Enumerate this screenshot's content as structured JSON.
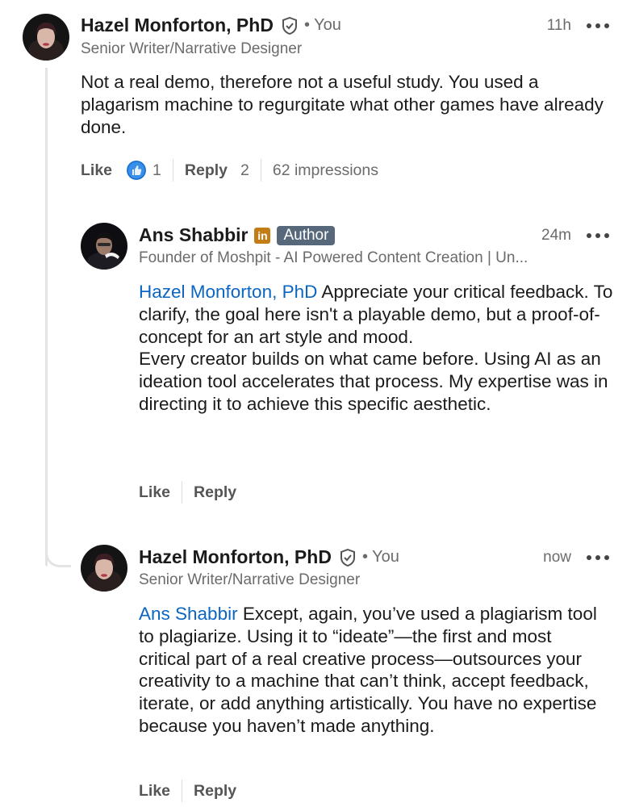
{
  "comments": [
    {
      "name": "Hazel Monforton, PhD",
      "you_label": "• You",
      "subtitle": "Senior Writer/Narrative Designer",
      "time": "11h",
      "body": "Not a real demo, therefore not a useful study. You used a plagarism machine to regurgitate what other games have already done.",
      "like_label": "Like",
      "like_count": "1",
      "reply_label": "Reply",
      "reply_count": "2",
      "impressions": "62 impressions"
    },
    {
      "name": "Ans Shabbir",
      "linkedin_badge": "in",
      "author_badge": "Author",
      "subtitle": "Founder of Moshpit - AI Powered Content Creation | Un...",
      "time": "24m",
      "mention": "Hazel Monforton, PhD",
      "body_p1": " Appreciate your critical feedback. To clarify, the goal here isn't a playable demo, but a proof-of-concept for an art style and mood.",
      "body_p2": "Every creator builds on what came before. Using AI as an ideation tool accelerates that process. My expertise was in directing it to achieve this specific aesthetic.",
      "like_label": "Like",
      "reply_label": "Reply"
    },
    {
      "name": "Hazel Monforton, PhD",
      "you_label": "• You",
      "subtitle": "Senior Writer/Narrative Designer",
      "time": "now",
      "mention": "Ans Shabbir",
      "body": " Except, again, you’ve used a plagiarism tool to plagiarize. Using it to “ideate”—the first and most critical part of a real creative process—outsources your creativity to a machine that can’t think, accept feedback, iterate, or add anything artistically. You have no expertise because you haven’t made anything.",
      "like_label": "Like",
      "reply_label": "Reply"
    }
  ],
  "colors": {
    "mention": "#0a66c2",
    "reaction_like": "#378fe9",
    "author_badge": "#56687a",
    "linkedin_badge": "#c37d16"
  }
}
